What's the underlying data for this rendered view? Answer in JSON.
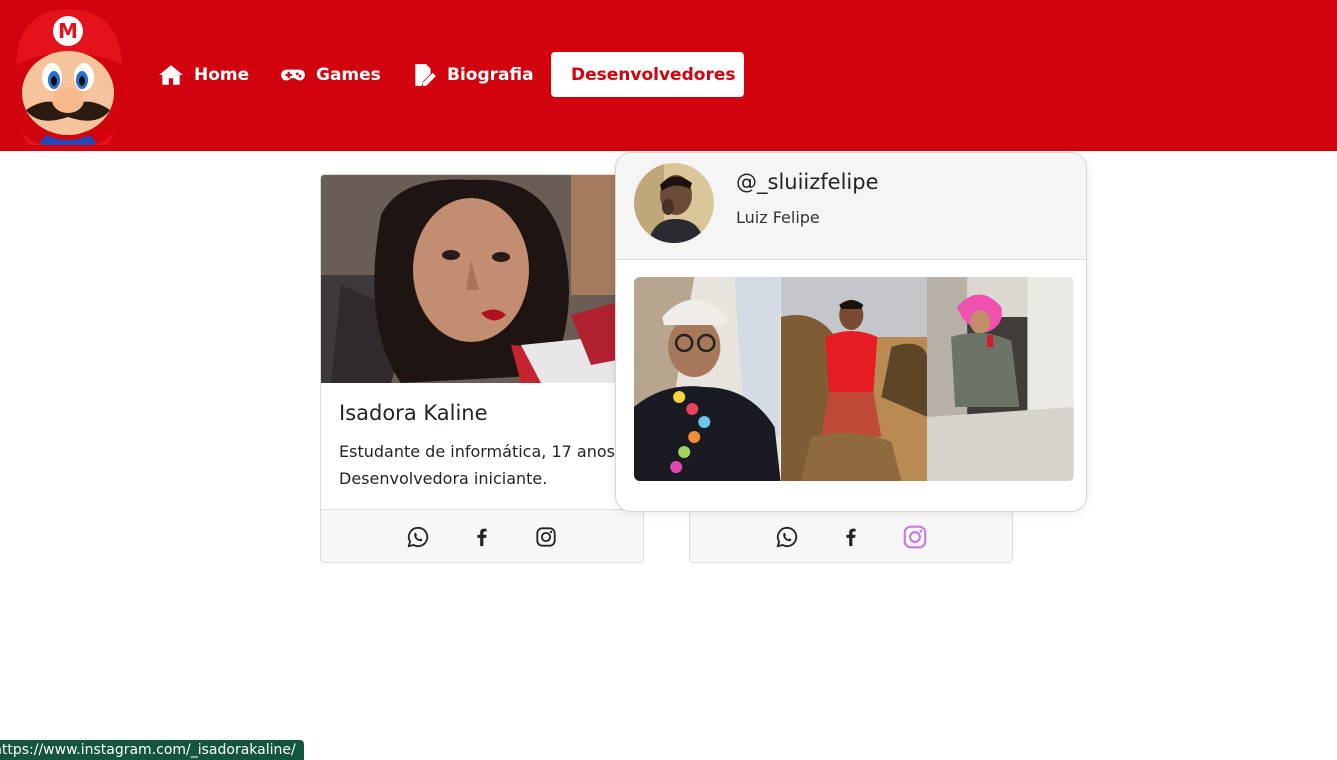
{
  "nav": {
    "items": [
      {
        "label": "Home",
        "icon": "home-icon"
      },
      {
        "label": "Games",
        "icon": "gamepad-icon"
      },
      {
        "label": "Biografia",
        "icon": "edit-document-icon"
      },
      {
        "label": "Desenvolvedores",
        "icon": "laptop-code-icon",
        "active": true
      }
    ]
  },
  "cards": [
    {
      "name": "Isadora Kaline",
      "description": "Estudante de informática, 17 anos. Desenvolvedora iniciante.",
      "social": [
        "whatsapp-icon",
        "facebook-icon",
        "instagram-icon"
      ]
    },
    {
      "social": [
        "whatsapp-icon",
        "facebook-icon",
        "instagram-icon"
      ],
      "instagram_hover_color": "#c77ddb"
    }
  ],
  "popover": {
    "handle": "@_sluiizfelipe",
    "name": "Luiz Felipe"
  },
  "status_url": "https://www.instagram.com/_isadorakaline/",
  "colors": {
    "brand_red": "#d0030f",
    "status_bar": "#14553d"
  }
}
